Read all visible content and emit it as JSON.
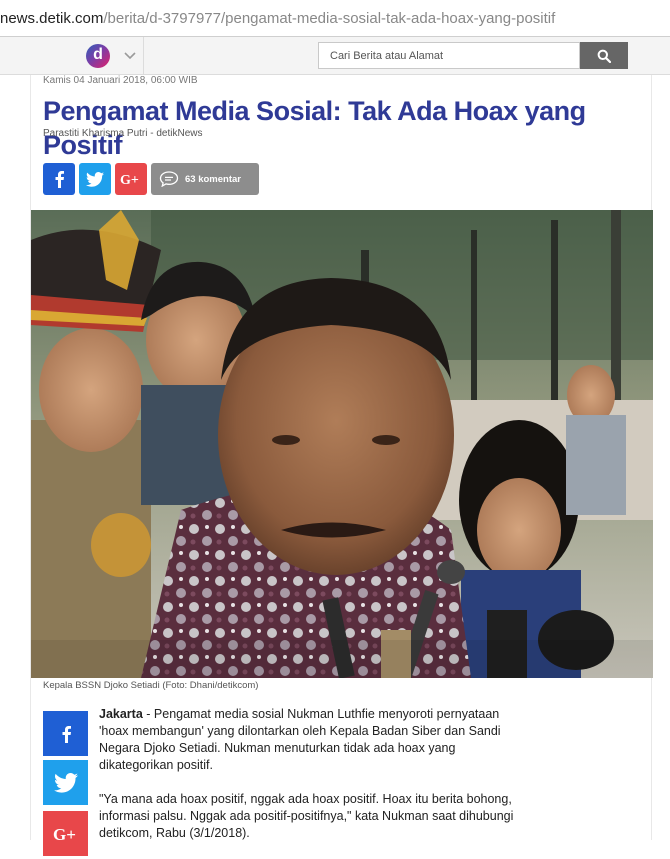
{
  "browser": {
    "url_host": "news.detik.com",
    "url_path": "/berita/d-3797977/pengamat-media-sosial-tak-ada-hoax-yang-positif"
  },
  "header": {
    "logo_letter": "d",
    "search_placeholder": "Cari Berita atau Alamat"
  },
  "article": {
    "date": "Kamis 04 Januari 2018, 06:00 WIB",
    "title": "Pengamat Media Sosial: Tak Ada Hoax yang Positif",
    "author": "Parastiti Kharisma Putri - detikNews",
    "comments_label": "63 komentar",
    "photo_caption": "Kepala BSSN Djoko Setiadi (Foto: Dhani/detikcom)",
    "dateline": "Jakarta",
    "para1_rest": " - Pengamat media sosial Nukman Luthfie menyoroti pernyataan 'hoax membangun' yang dilontarkan oleh Kepala Badan Siber dan Sandi Negara Djoko Setiadi. Nukman menuturkan tidak ada hoax yang dikategorikan positif.",
    "para2": "\"Ya mana ada hoax positif, nggak ada hoax positif. Hoax itu berita bohong, informasi palsu. Nggak ada positif-positifnya,\" kata Nukman saat dihubungi detikcom, Rabu (3/1/2018)."
  },
  "colors": {
    "title": "#2f3a96",
    "facebook": "#1f5fd4",
    "twitter": "#1fa0ec",
    "googleplus": "#e8474a",
    "comment": "#8d8d8d"
  }
}
